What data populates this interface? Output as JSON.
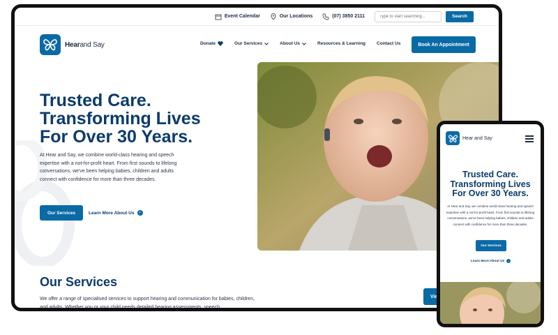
{
  "topbar": {
    "event_calendar": "Event Calendar",
    "our_locations": "Our Locations",
    "phone": "(07) 3850 2111",
    "search_placeholder": "Type to start searching...",
    "search_button": "Search"
  },
  "brand": {
    "name_bold": "Hear",
    "name_light": "and Say",
    "mobile_name": "Hear and Say",
    "color": "#0a6aa6"
  },
  "nav": {
    "items": [
      {
        "label": "Donate",
        "icon": "heart-icon"
      },
      {
        "label": "Our Services",
        "icon": "chevron-down-icon"
      },
      {
        "label": "About Us",
        "icon": "chevron-down-icon"
      },
      {
        "label": "Resources & Learning"
      },
      {
        "label": "Contact Us"
      }
    ],
    "cta": "Book An Appointment"
  },
  "hero": {
    "title_lines": [
      "Trusted Care.",
      "Transforming Lives",
      "For Over 30 Years."
    ],
    "body": "At Hear and Say, we combine world-class hearing and speech expertise with a not-for-profit heart. From first sounds to lifelong conversations, we've been helping babies, children and adults connect with confidence for more than three decades.",
    "primary_button": "Our Services",
    "secondary_link": "Learn More About Us"
  },
  "services": {
    "title": "Our Services",
    "body": "We offer a range of specialised services to support hearing and communication for babies, children, and adults. Whether you or your child needs detailed hearing assessments, speech",
    "view_button": "Vie"
  },
  "mobile": {
    "title_lines": [
      "Trusted Care.",
      "Transforming Lives",
      "For Over 30 Years."
    ],
    "body": "At Hear and Say, we combine world-class hearing and speech expertise with a not-for-profit heart. From first sounds to lifelong conversations, we've been helping babies, children and adults connect with confidence for more than three decades.",
    "button": "Our Services",
    "link": "Learn More About Us"
  }
}
